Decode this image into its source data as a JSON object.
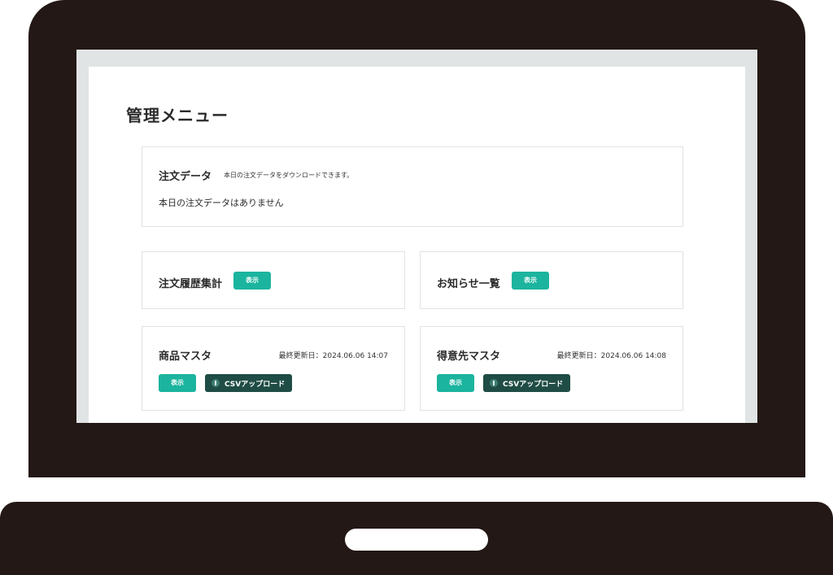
{
  "page": {
    "title": "管理メニュー"
  },
  "order_data": {
    "title": "注文データ",
    "description": "本日の注文データをダウンロードできます。",
    "status": "本日の注文データはありません"
  },
  "order_history": {
    "title": "注文履歴集計",
    "show_label": "表示"
  },
  "notices": {
    "title": "お知らせ一覧",
    "show_label": "表示"
  },
  "product_master": {
    "title": "商品マスタ",
    "updated": "最終更新日：2024.06.06 14:07",
    "show_label": "表示",
    "csv_label": "CSVアップロード"
  },
  "customer_master": {
    "title": "得意先マスタ",
    "updated": "最終更新日：2024.06.06 14:08",
    "show_label": "表示",
    "csv_label": "CSVアップロード"
  },
  "colors": {
    "frame": "#231815",
    "accent": "#1bb49e",
    "dark_button": "#1f4d45",
    "screen_margin": "#e1e4e5"
  }
}
